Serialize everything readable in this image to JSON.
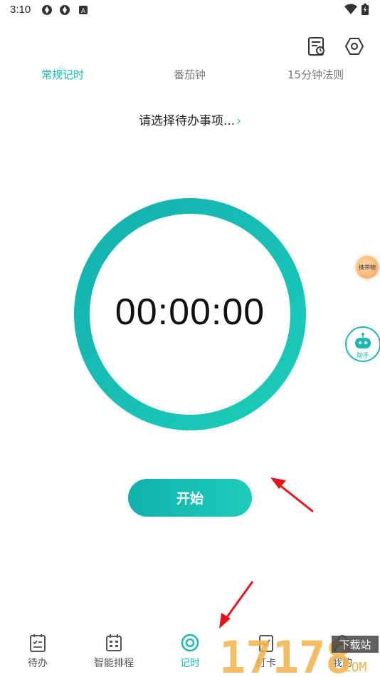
{
  "status_bar": {
    "time": "3:10",
    "icons": [
      "app-icon",
      "app-icon",
      "a-icon",
      "wifi-icon",
      "battery-icon"
    ]
  },
  "header": {
    "icons": [
      "record-list-icon",
      "settings-hex-icon"
    ]
  },
  "tabs": [
    {
      "label": "常规记时",
      "active": true
    },
    {
      "label": "番茄钟",
      "active": false
    },
    {
      "label": "15分钟法则",
      "active": false
    }
  ],
  "task_selector": {
    "label": "请选择待办事项...",
    "chevron": "›"
  },
  "timer": {
    "display": "00:00:00",
    "progress": 1.0
  },
  "colors": {
    "accent": "#1fb8b0",
    "ring_start": "#13b0b0",
    "ring_end": "#1ccdb9",
    "arrow": "#e3141b"
  },
  "floating": {
    "carry_label": "携带物",
    "assistant_label": "助手"
  },
  "start_button": {
    "label": "开始"
  },
  "bottom_nav": [
    {
      "label": "待办",
      "icon": "todo-list-icon",
      "active": false
    },
    {
      "label": "智能排程",
      "icon": "calendar-icon",
      "active": false
    },
    {
      "label": "记时",
      "icon": "timer-ring-icon",
      "active": true
    },
    {
      "label": "打卡",
      "icon": "checkin-icon",
      "active": false
    },
    {
      "label": "我的",
      "icon": "profile-icon",
      "active": false
    }
  ],
  "watermark": {
    "text": "17178",
    "sub": "下载站",
    "domain": "COM"
  }
}
